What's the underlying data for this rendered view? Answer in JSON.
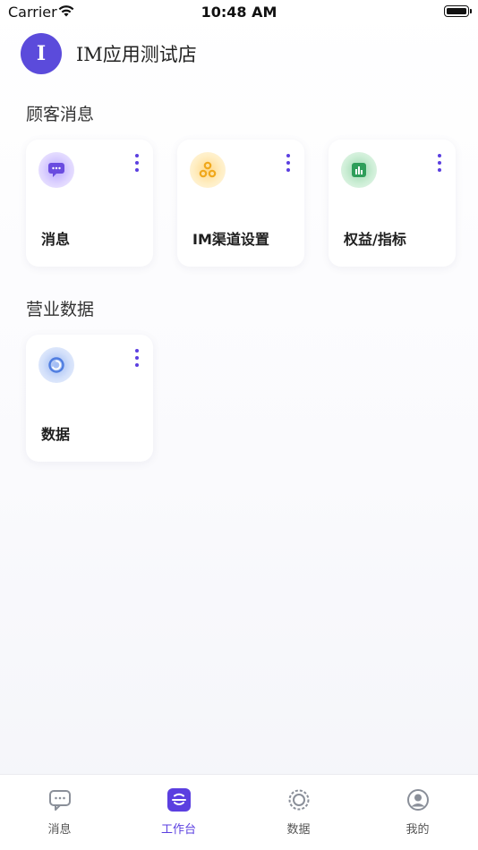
{
  "status_bar": {
    "carrier": "Carrier",
    "time": "10:48 AM"
  },
  "shop": {
    "avatar_letter": "I",
    "name": "IM应用测试店"
  },
  "sections": [
    {
      "title": "顾客消息",
      "cards": [
        {
          "label": "消息",
          "icon": "message-icon",
          "color": "#7b5cf0"
        },
        {
          "label": "IM渠道设置",
          "icon": "channel-settings-icon",
          "color": "#f4b73c"
        },
        {
          "label": "权益/指标",
          "icon": "chart-icon",
          "color": "#3fae6a"
        }
      ]
    },
    {
      "title": "营业数据",
      "cards": [
        {
          "label": "数据",
          "icon": "data-ring-icon",
          "color": "#4f7de0"
        }
      ]
    }
  ],
  "tab_bar": {
    "active_index": 1,
    "accent": "#5b3fe0",
    "tabs": [
      {
        "label": "消息",
        "icon": "message-tab-icon"
      },
      {
        "label": "工作台",
        "icon": "workbench-tab-icon"
      },
      {
        "label": "数据",
        "icon": "data-tab-icon"
      },
      {
        "label": "我的",
        "icon": "profile-tab-icon"
      }
    ]
  }
}
